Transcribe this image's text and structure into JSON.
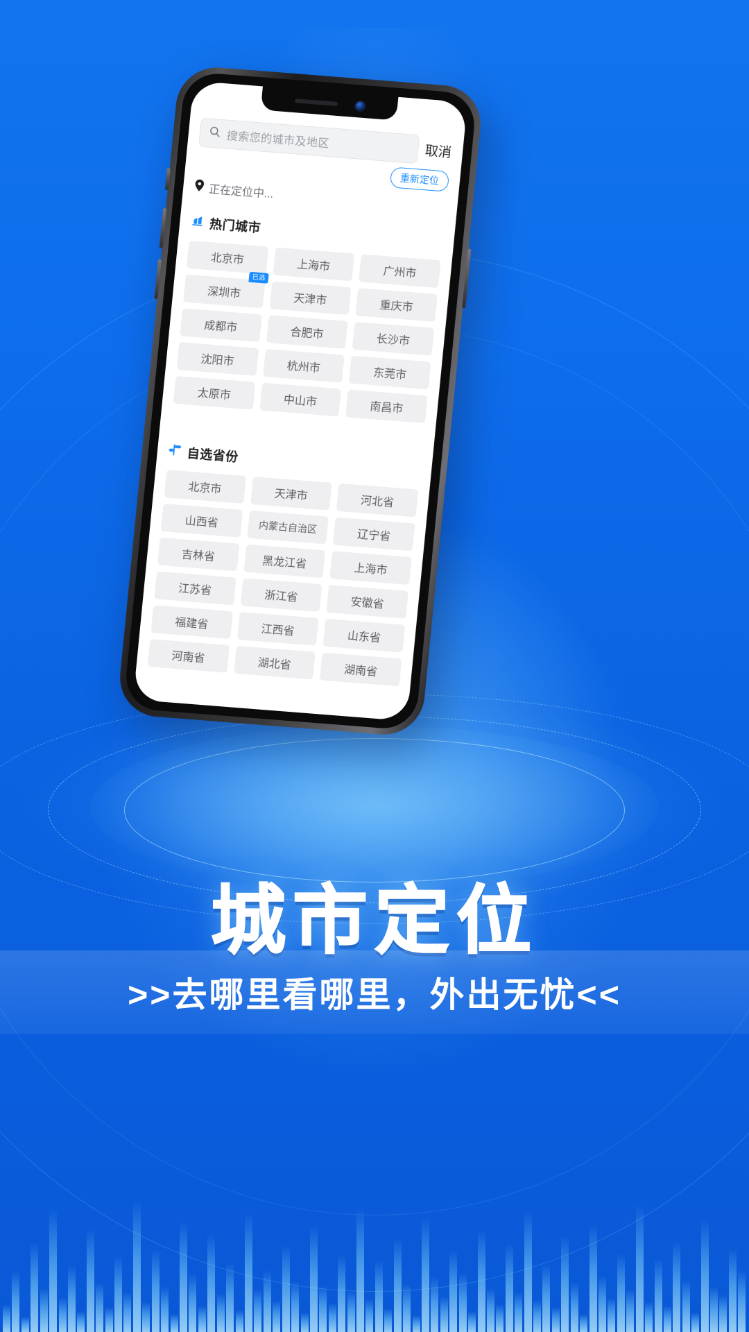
{
  "poster": {
    "headline": "城市定位",
    "subline": ">>去哪里看哪里，外出无忧<<",
    "brand_blue": "#0d6ded",
    "accent_blue": "#1a8cff"
  },
  "app": {
    "search": {
      "icon": "search-icon",
      "placeholder": "搜索您的城市及地区",
      "value": ""
    },
    "cancel_label": "取消",
    "relocate_label": "重新定位",
    "locating": {
      "icon": "location-pin-icon",
      "text": "正在定位中..."
    },
    "hot_cities": {
      "icon": "building-icon",
      "title": "热门城市",
      "selected_badge": "已选",
      "selected_city": "深圳市",
      "items": [
        "北京市",
        "上海市",
        "广州市",
        "深圳市",
        "天津市",
        "重庆市",
        "成都市",
        "合肥市",
        "长沙市",
        "沈阳市",
        "杭州市",
        "东莞市",
        "太原市",
        "中山市",
        "南昌市"
      ]
    },
    "provinces": {
      "icon": "signpost-icon",
      "title": "自选省份",
      "items": [
        "北京市",
        "天津市",
        "河北省",
        "山西省",
        "内蒙古自治区",
        "辽宁省",
        "吉林省",
        "黑龙江省",
        "上海市",
        "江苏省",
        "浙江省",
        "安徽省",
        "福建省",
        "江西省",
        "山东省",
        "河南省",
        "湖北省",
        "湖南省"
      ]
    }
  }
}
